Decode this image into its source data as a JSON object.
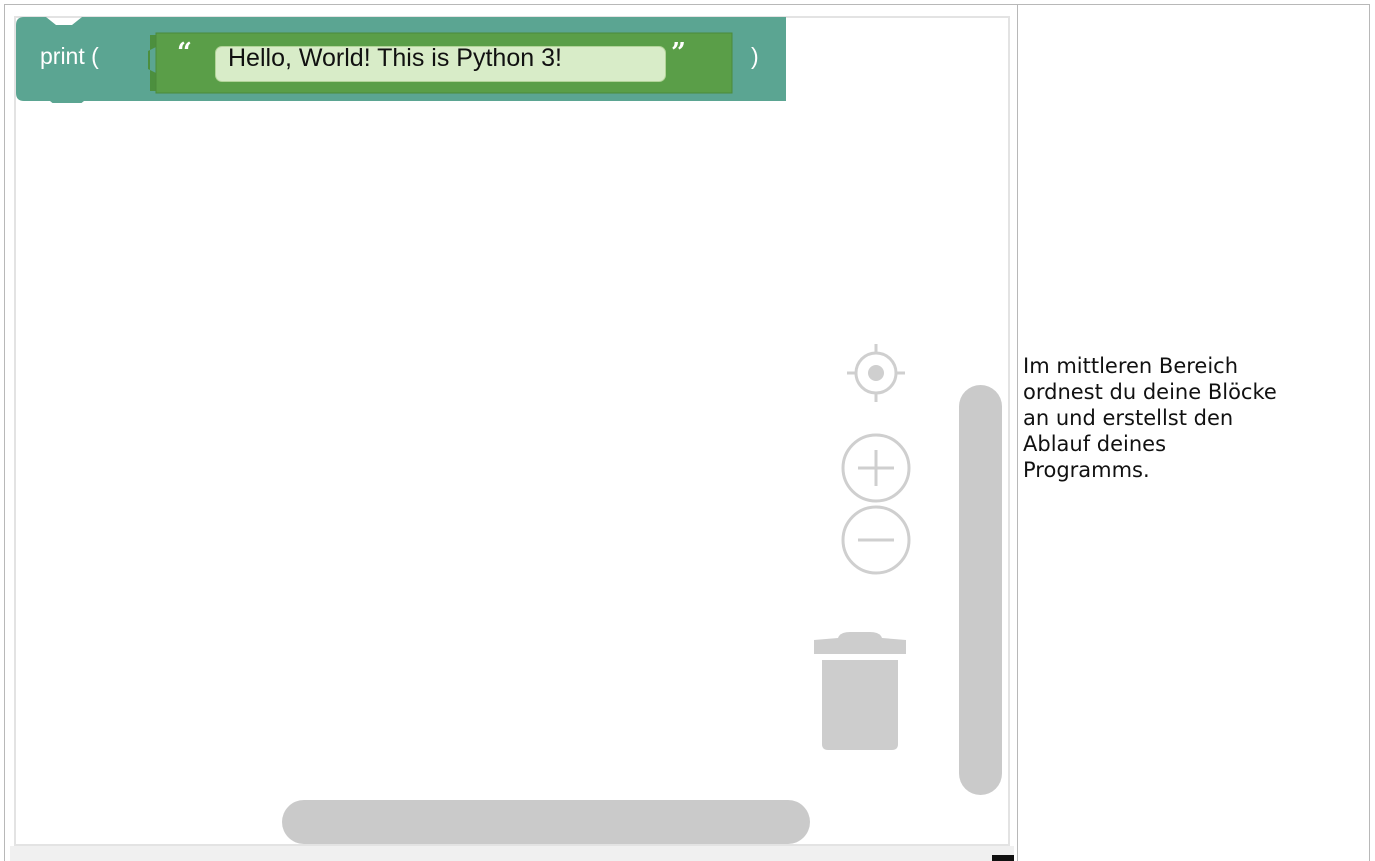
{
  "workspace": {
    "block": {
      "function_label": "print (",
      "close_label": ")",
      "open_quote": "“",
      "close_quote": "”",
      "string_value": "Hello, World! This is Python 3!"
    },
    "colors": {
      "print_block": "#5ba592",
      "text_block": "#5a9e48",
      "string_field": "#d8ecc8",
      "scrollbar": "#cacaca",
      "controls": "#d0d0d0"
    },
    "controls": {
      "recenter_icon": "target-icon",
      "zoom_in_icon": "plus-circle-icon",
      "zoom_out_icon": "minus-circle-icon",
      "trash_icon": "trash-icon"
    }
  },
  "description": {
    "text": "Im mittleren Bereich\nordnest du deine Blöcke\nan und erstellst den\nAblauf deines\nProgramms."
  }
}
